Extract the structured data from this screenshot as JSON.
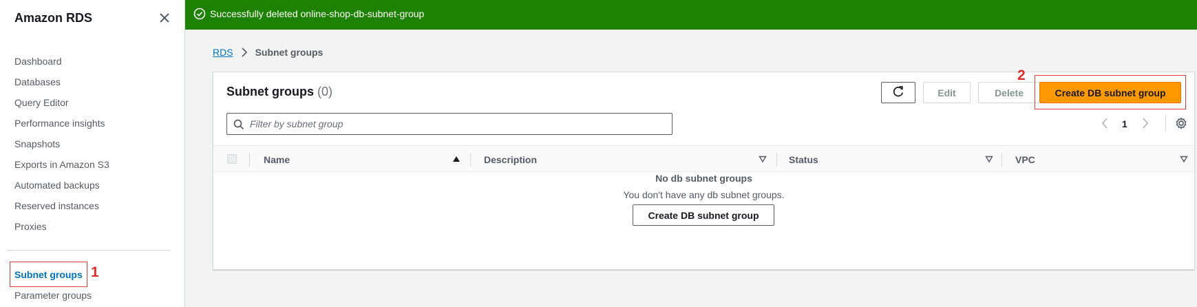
{
  "sidebar": {
    "title": "Amazon RDS",
    "items": [
      {
        "label": "Dashboard"
      },
      {
        "label": "Databases"
      },
      {
        "label": "Query Editor"
      },
      {
        "label": "Performance insights"
      },
      {
        "label": "Snapshots"
      },
      {
        "label": "Exports in Amazon S3"
      },
      {
        "label": "Automated backups"
      },
      {
        "label": "Reserved instances"
      },
      {
        "label": "Proxies"
      }
    ],
    "active_item": {
      "label": "Subnet groups"
    },
    "next_item": {
      "label": "Parameter groups"
    }
  },
  "flash": {
    "message": "Successfully deleted online-shop-db-subnet-group",
    "color": "#1d8102"
  },
  "breadcrumb": {
    "root": "RDS",
    "current": "Subnet groups"
  },
  "panel": {
    "title": "Subnet groups",
    "count": "(0)",
    "buttons": {
      "edit": "Edit",
      "delete": "Delete",
      "create": "Create DB subnet group"
    },
    "filter": {
      "placeholder": "Filter by subnet group",
      "value": ""
    },
    "pagination": {
      "current_page": "1"
    },
    "columns": [
      "Name",
      "Description",
      "Status",
      "VPC"
    ],
    "empty": {
      "title": "No db subnet groups",
      "message": "You don't have any db subnet groups.",
      "button": "Create DB subnet group"
    }
  },
  "annotations": {
    "one": "1",
    "two": "2"
  },
  "colors": {
    "accent_link": "#0073bb",
    "primary_button": "#ff9900",
    "annotation": "#e02b2b"
  }
}
